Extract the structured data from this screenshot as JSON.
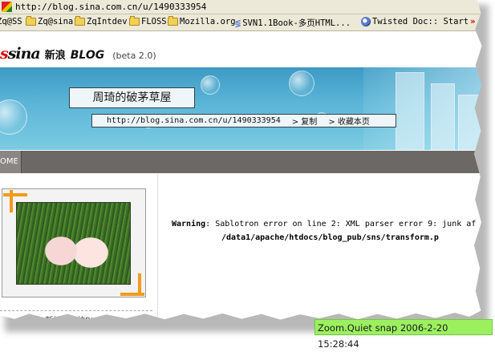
{
  "browser": {
    "url": "http://blog.sina.com.cn/u/1490333954",
    "bookmarks": [
      {
        "label": "Zq@SS",
        "icon": "folder-icon"
      },
      {
        "label": "Zq@sina",
        "icon": "folder-icon"
      },
      {
        "label": "ZqIntdev",
        "icon": "folder-icon"
      },
      {
        "label": "FLOSS",
        "icon": "folder-icon"
      },
      {
        "label": "Mozilla.org",
        "icon": "folder-icon"
      },
      {
        "label": "SVN1.1Book-多页HTML...",
        "icon": "svn-page-icon"
      },
      {
        "label": "Twisted Doc:: Start",
        "icon": "page-icon"
      }
    ]
  },
  "header": {
    "logo": "sina",
    "site_name": "新浪",
    "blog_word": "BLOG",
    "beta": "(beta 2.0)"
  },
  "banner": {
    "blog_title": "周琦的破茅草屋",
    "blog_url": "http://blog.sina.com.cn/u/1490333954",
    "copy_link": "> 复制",
    "favorite_link": "> 收藏本页"
  },
  "nav": {
    "home_label": "OME"
  },
  "sidebar": {
    "photo_caption": "断枳飞红的BLOG"
  },
  "main": {
    "warning_label": "Warning",
    "warning_text": ": Sablotron error on line 2: XML parser error 9: junk af",
    "warning_path": "/data1/apache/htdocs/blog_pub/sns/transform.p"
  },
  "overlay": {
    "snap_label": "Zoom.Quiet snap 2006-2-20 15:28:44"
  },
  "colors": {
    "banner_blue": "#5cb6d8",
    "navbar": "#6b6866",
    "accent_orange": "#f39a1b",
    "snap_green": "#9cf060"
  }
}
